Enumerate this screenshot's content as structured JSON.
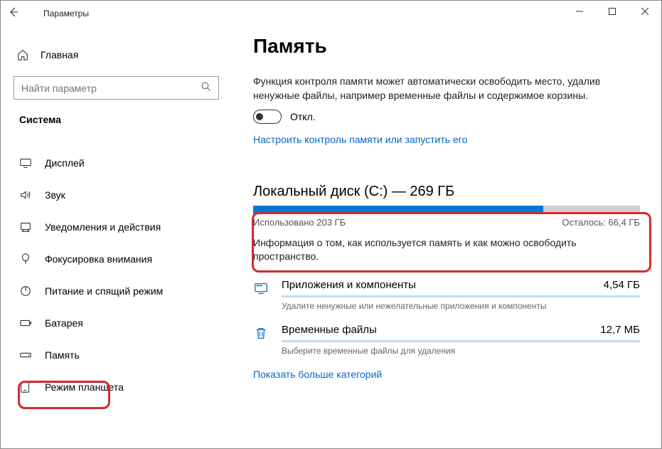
{
  "window": {
    "title": "Параметры"
  },
  "sidebar": {
    "home": "Главная",
    "search_placeholder": "Найти параметр",
    "section": "Система",
    "items": [
      {
        "label": "Дисплей"
      },
      {
        "label": "Звук"
      },
      {
        "label": "Уведомления и действия"
      },
      {
        "label": "Фокусировка внимания"
      },
      {
        "label": "Питание и спящий режим"
      },
      {
        "label": "Батарея"
      },
      {
        "label": "Память"
      },
      {
        "label": "Режим планшета"
      }
    ]
  },
  "main": {
    "heading": "Память",
    "description": "Функция контроля памяти может автоматически освободить место, удалив ненужные файлы, например временные файлы и содержимое корзины.",
    "toggle_label": "Откл.",
    "configure_link": "Настроить контроль памяти или запустить его",
    "disk": {
      "title": "Локальный диск (C:) — 269 ГБ",
      "used_label": "Использовано 203 ГБ",
      "free_label": "Осталось: 66,4 ГБ",
      "percent_used": 75
    },
    "info": "Информация о том, как используется память и как можно освободить пространство.",
    "categories": [
      {
        "title": "Приложения и компоненты",
        "size": "4,54 ГБ",
        "sub": "Удалите ненужные или нежелательные приложения и компоненты"
      },
      {
        "title": "Временные файлы",
        "size": "12,7 МБ",
        "sub": "Выберите временные файлы для удаления"
      }
    ],
    "show_more": "Показать больше категорий"
  }
}
